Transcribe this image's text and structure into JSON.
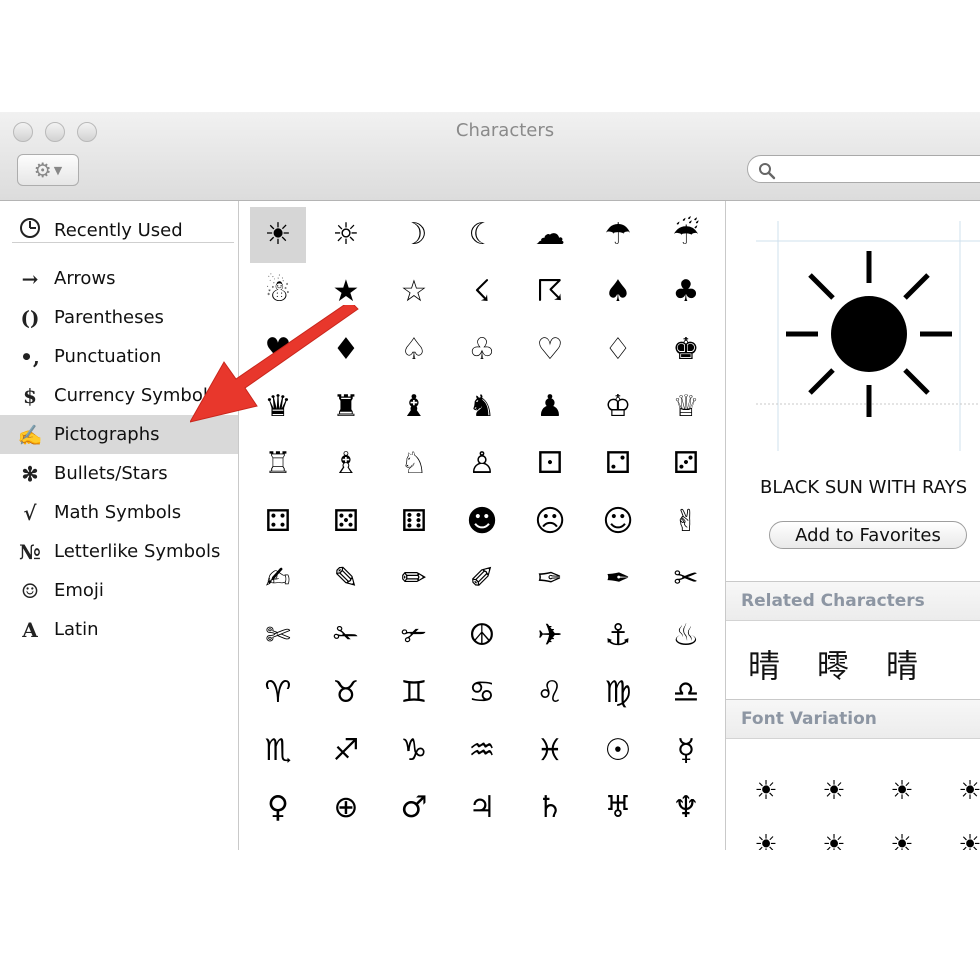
{
  "window": {
    "title": "Characters"
  },
  "toolbar": {
    "search_placeholder": ""
  },
  "sidebar": {
    "items": [
      {
        "icon": "clock-icon",
        "glyph": "",
        "label": "Recently Used"
      },
      {
        "icon": "arrow-icon",
        "glyph": "→",
        "label": "Arrows"
      },
      {
        "icon": "parentheses-icon",
        "glyph": "()",
        "label": "Parentheses"
      },
      {
        "icon": "punctuation-icon",
        "glyph": "•,",
        "label": "Punctuation"
      },
      {
        "icon": "dollar-icon",
        "glyph": "$",
        "label": "Currency Symbols"
      },
      {
        "icon": "pictograph-icon",
        "glyph": "✍",
        "label": "Pictographs"
      },
      {
        "icon": "asterisk-icon",
        "glyph": "✻",
        "label": "Bullets/Stars"
      },
      {
        "icon": "sqrt-icon",
        "glyph": "√",
        "label": "Math Symbols"
      },
      {
        "icon": "numero-icon",
        "glyph": "№",
        "label": "Letterlike Symbols"
      },
      {
        "icon": "smiley-icon",
        "glyph": "☺",
        "label": "Emoji"
      },
      {
        "icon": "latin-icon",
        "glyph": "A",
        "label": "Latin"
      }
    ],
    "selected_label": "Pictographs"
  },
  "grid": {
    "characters": [
      "☀",
      "☼",
      "☽",
      "☾",
      "☁",
      "☂",
      "☔",
      "☃",
      "★",
      "☆",
      "☇",
      "☈",
      "♠",
      "♣",
      "♥",
      "♦",
      "♤",
      "♧",
      "♡",
      "♢",
      "♚",
      "♛",
      "♜",
      "♝",
      "♞",
      "♟",
      "♔",
      "♕",
      "♖",
      "♗",
      "♘",
      "♙",
      "⚀",
      "⚁",
      "⚂",
      "⚃",
      "⚄",
      "⚅",
      "☻",
      "☹",
      "☺",
      "✌",
      "✍",
      "✎",
      "✏",
      "✐",
      "✑",
      "✒",
      "✂",
      "✄",
      "✁",
      "✃",
      "☮",
      "✈",
      "⚓",
      "♨",
      "♈",
      "♉",
      "♊",
      "♋",
      "♌",
      "♍",
      "♎",
      "♏",
      "♐",
      "♑",
      "♒",
      "♓",
      "☉",
      "☿",
      "♀",
      "⊕",
      "♂",
      "♃",
      "♄",
      "♅",
      "♆"
    ],
    "selected_index": 0
  },
  "detail": {
    "preview_char": "☀",
    "char_name": "BLACK SUN WITH RAYS",
    "favorites_button": "Add to Favorites",
    "related_header": "Related Characters",
    "related": [
      "晴",
      "㬡",
      "晴"
    ],
    "font_variation_header": "Font Variation",
    "variations": [
      "☀",
      "☀",
      "☀",
      "☀",
      "☀",
      "☀",
      "☀",
      "☀"
    ]
  },
  "colors": {
    "arrow": "#e8372c",
    "selection": "#d9d9d9",
    "header_text": "#8d96a3"
  }
}
